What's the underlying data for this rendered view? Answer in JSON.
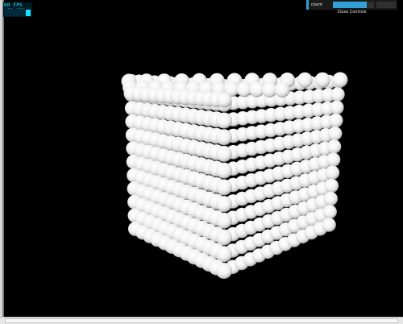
{
  "stats": {
    "fps_text": "60 FPS (60-60)",
    "graph_level": 0.85
  },
  "controls": {
    "param_label": "count",
    "param_value": "",
    "slider_fill": 0.82,
    "close_label": "Close Controls"
  },
  "scene": {
    "object": "cube of spheres",
    "grid_columns": 13,
    "grid_rows": 12,
    "sphere_color": "#ffffff",
    "background": "#000000"
  },
  "colors": {
    "accent": "#2fa1d6",
    "stats_text": "#1fe6ff"
  }
}
